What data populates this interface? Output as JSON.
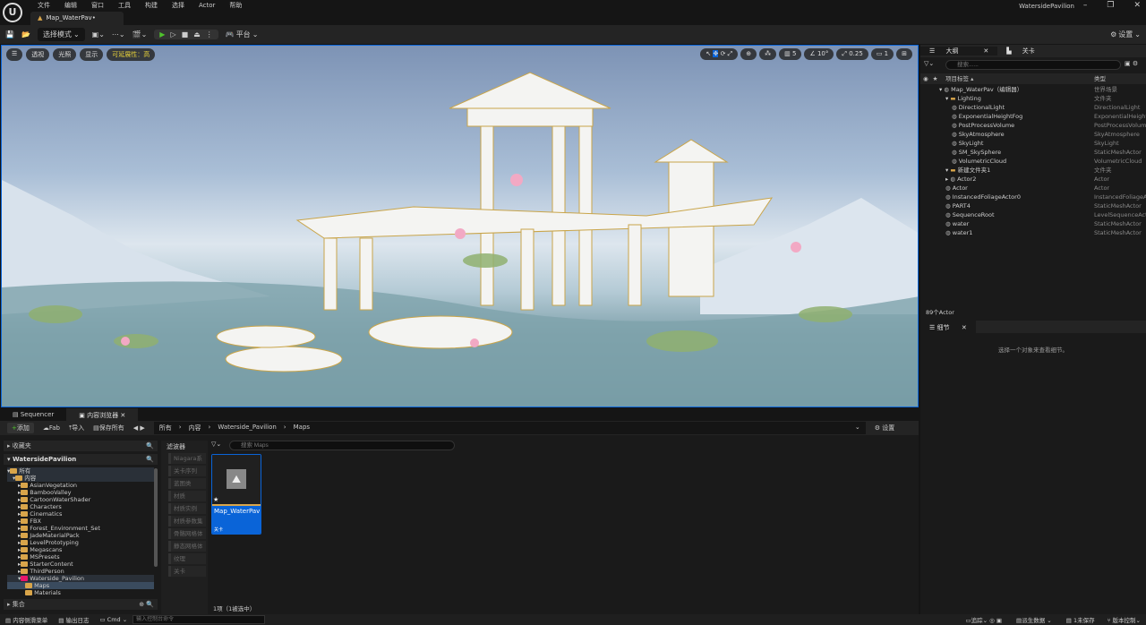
{
  "app": {
    "logo": "U",
    "menu": [
      "文件",
      "编辑",
      "窗口",
      "工具",
      "构建",
      "选择",
      "Actor",
      "帮助"
    ],
    "doc_tab": "Map_WaterPav•",
    "window_title": "WatersidePavilion"
  },
  "toolbar": {
    "mode": "选择模式",
    "platform": "平台",
    "settings": "设置"
  },
  "viewport": {
    "pills": [
      "透视",
      "光照",
      "显示"
    ],
    "scalability": "可延展性：高",
    "grid": "5",
    "angle": "10°",
    "scale": "0.25",
    "camera": "1"
  },
  "outliner": {
    "tabs": [
      "大纲",
      "关卡"
    ],
    "search_placeholder": "搜索......",
    "col_label": "项目标签 ▴",
    "col_type": "类型",
    "rows": [
      {
        "indent": 3,
        "arrow": "▾",
        "name": "Map_WaterPav（编辑器）",
        "type": "世界场景",
        "folder": false
      },
      {
        "indent": 4,
        "arrow": "▾",
        "name": "Lighting",
        "type": "文件夹",
        "folder": true
      },
      {
        "indent": 5,
        "arrow": "",
        "name": "DirectionalLight",
        "type": "DirectionalLight"
      },
      {
        "indent": 5,
        "arrow": "",
        "name": "ExponentialHeightFog",
        "type": "ExponentialHeightFog"
      },
      {
        "indent": 5,
        "arrow": "",
        "name": "PostProcessVolume",
        "type": "PostProcessVolume"
      },
      {
        "indent": 5,
        "arrow": "",
        "name": "SkyAtmosphere",
        "type": "SkyAtmosphere"
      },
      {
        "indent": 5,
        "arrow": "",
        "name": "SkyLight",
        "type": "SkyLight"
      },
      {
        "indent": 5,
        "arrow": "",
        "name": "SM_SkySphere",
        "type": "StaticMeshActor"
      },
      {
        "indent": 5,
        "arrow": "",
        "name": "VolumetricCloud",
        "type": "VolumetricCloud"
      },
      {
        "indent": 4,
        "arrow": "▾",
        "name": "新建文件夹1",
        "type": "文件夹",
        "folder": true
      },
      {
        "indent": 4,
        "arrow": "▸",
        "name": "Actor2",
        "type": "Actor"
      },
      {
        "indent": 4,
        "arrow": "",
        "name": "Actor",
        "type": "Actor"
      },
      {
        "indent": 4,
        "arrow": "",
        "name": "InstancedFoliageActor0",
        "type": "InstancedFoliageActor"
      },
      {
        "indent": 4,
        "arrow": "",
        "name": "PART4",
        "type": "StaticMeshActor"
      },
      {
        "indent": 4,
        "arrow": "",
        "name": "SequenceRoot",
        "type": "LevelSequenceActor"
      },
      {
        "indent": 4,
        "arrow": "",
        "name": "water",
        "type": "StaticMeshActor"
      },
      {
        "indent": 4,
        "arrow": "",
        "name": "water1",
        "type": "StaticMeshActor"
      }
    ],
    "count": "89个Actor"
  },
  "details": {
    "tab": "细节",
    "empty": "选择一个对象来查看细节。"
  },
  "bottom": {
    "tabs": [
      "Sequencer",
      "内容浏览器"
    ],
    "add": "添加",
    "fab": "Fab",
    "import": "导入",
    "save_all": "保存所有",
    "breadcrumb": [
      "所有",
      "内容",
      "Waterside_Pavilion",
      "Maps"
    ],
    "settings": "设置",
    "favorites": "收藏夹",
    "project": "WatersidePavilion",
    "filter_title": "滤波器",
    "search_placeholder": "搜索 Maps",
    "tree": [
      {
        "d": 0,
        "name": "所有",
        "open": true
      },
      {
        "d": 1,
        "name": "内容",
        "open": true
      },
      {
        "d": 2,
        "name": "AsianVegetation"
      },
      {
        "d": 2,
        "name": "BambooValley"
      },
      {
        "d": 2,
        "name": "CartoonWaterShader"
      },
      {
        "d": 2,
        "name": "Characters"
      },
      {
        "d": 2,
        "name": "Cinematics"
      },
      {
        "d": 2,
        "name": "FBX"
      },
      {
        "d": 2,
        "name": "Forest_Environment_Set"
      },
      {
        "d": 2,
        "name": "JadeMaterialPack"
      },
      {
        "d": 2,
        "name": "LevelPrototyping"
      },
      {
        "d": 2,
        "name": "Megascans"
      },
      {
        "d": 2,
        "name": "MSPresets"
      },
      {
        "d": 2,
        "name": "StarterContent"
      },
      {
        "d": 2,
        "name": "ThirdPerson"
      },
      {
        "d": 2,
        "name": "Waterside_Pavilion",
        "open": true,
        "pink": true
      },
      {
        "d": 3,
        "name": "Maps",
        "sel": true
      },
      {
        "d": 3,
        "name": "Materials"
      }
    ],
    "filters": [
      "Niagara系统",
      "关卡序列",
      "蓝图类",
      "材质",
      "材质实例",
      "材质参数集",
      "骨骼网格体",
      "静态网格体",
      "纹理",
      "关卡"
    ],
    "collections": "集合",
    "asset": {
      "name": "Map_WaterPav",
      "type": "关卡"
    },
    "item_count": "1项（1被选中）"
  },
  "statusbar": {
    "drawer": "内容侧滑菜单",
    "log": "输出日志",
    "cmd": "Cmd",
    "cmd_placeholder": "输入控制台命令",
    "trace": "追踪",
    "derived": "派生数据",
    "unsaved": "1未保存",
    "source_control": "版本控制"
  }
}
